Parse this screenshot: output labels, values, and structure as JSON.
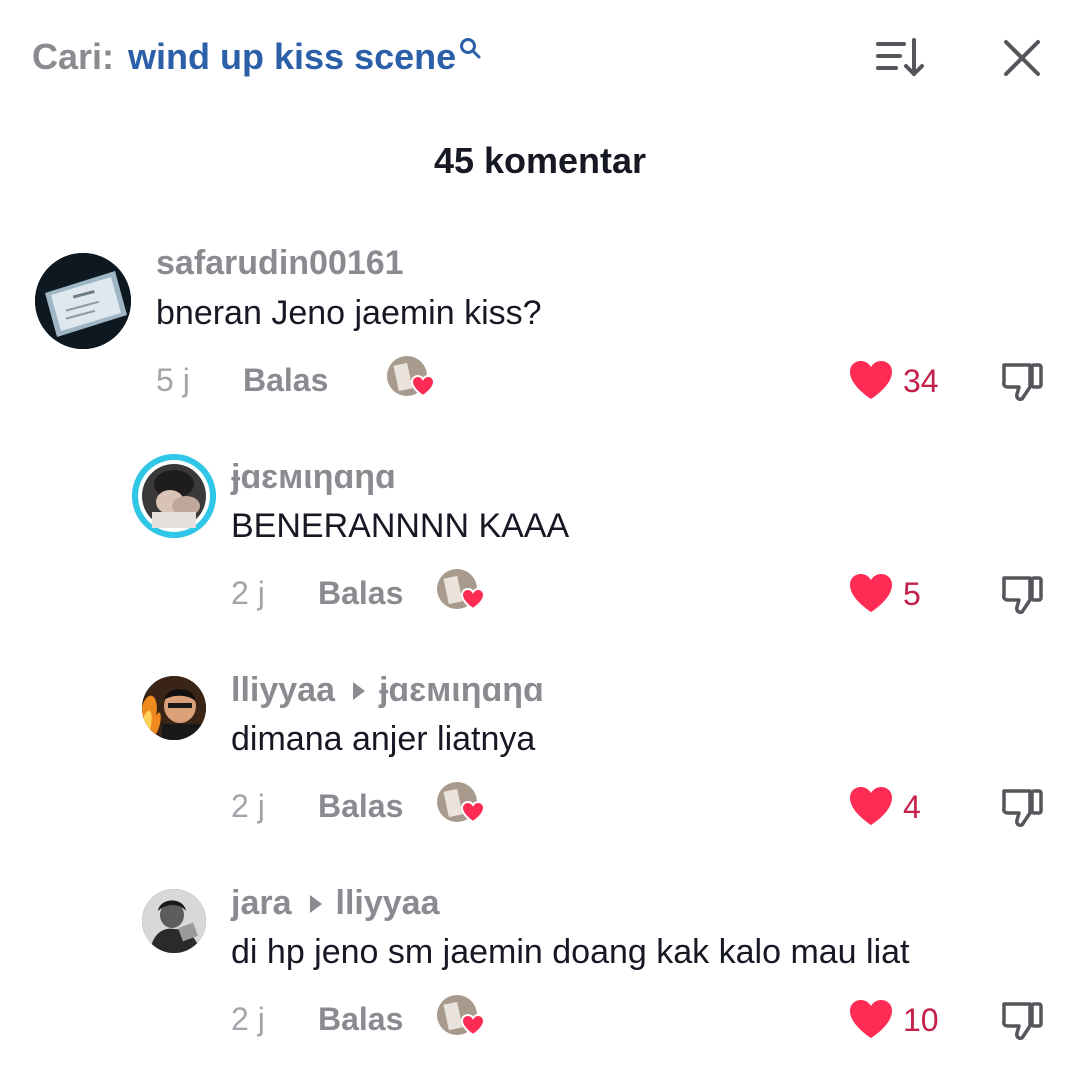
{
  "header": {
    "search_label": "Cari:",
    "search_query": "wind up kiss scene",
    "comment_count_title": "45 komentar"
  },
  "icons": {
    "search": "search-icon",
    "sort": "sort-icon",
    "close": "close-icon",
    "like": "heart-icon",
    "dislike": "thumbs-down-icon"
  },
  "colors": {
    "query_blue": "#2b5fa8",
    "like_red": "#fe2c55",
    "count_red": "#c4204a",
    "story_ring": "#2fc6e8"
  },
  "comments": [
    {
      "username": "safarudin00161",
      "reply_to": "",
      "text": "bneran Jeno jaemin kiss?",
      "time": "5 j",
      "reply_label": "Balas",
      "likes": "34"
    },
    {
      "username": "ɉɑɛмιηɑηɑ",
      "reply_to": "",
      "text": "BENERANNNN KAAA",
      "time": "2 j",
      "reply_label": "Balas",
      "likes": "5"
    },
    {
      "username": "lliyyaa",
      "reply_to": "ɉɑɛмιηɑηɑ",
      "text": "dimana anjer liatnya",
      "time": "2 j",
      "reply_label": "Balas",
      "likes": "4"
    },
    {
      "username": "jara",
      "reply_to": "lliyyaa",
      "text": "di hp jeno sm jaemin doang kak kalo mau liat",
      "time": "2 j",
      "reply_label": "Balas",
      "likes": "10"
    }
  ]
}
